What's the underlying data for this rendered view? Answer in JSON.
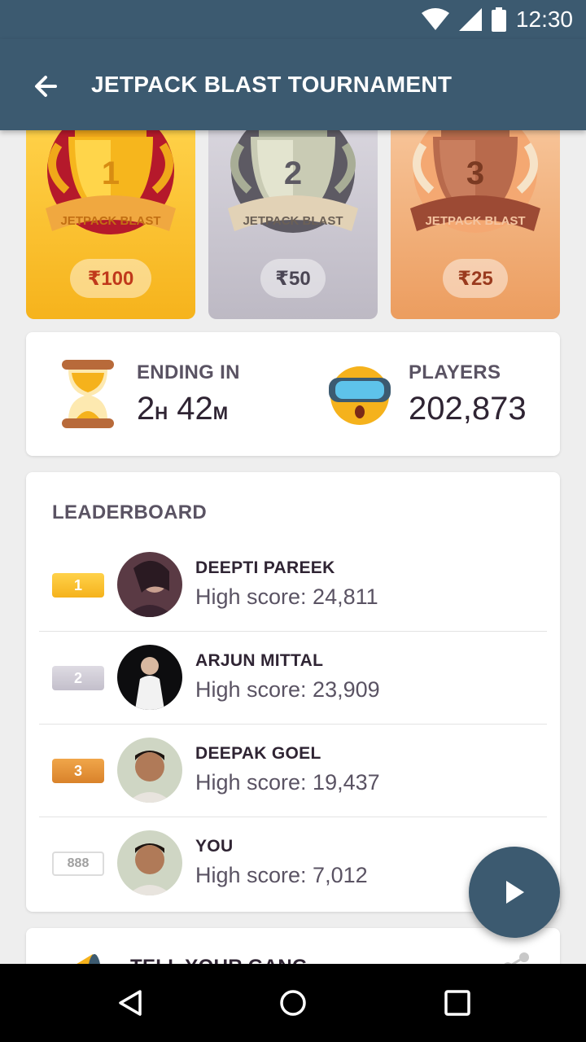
{
  "status_bar": {
    "time": "12:30"
  },
  "app_bar": {
    "title": "JETPACK BLAST TOURNAMENT"
  },
  "prizes": [
    {
      "rank": "1",
      "banner": "JETPACK BLAST",
      "amount": "₹100"
    },
    {
      "rank": "2",
      "banner": "JETPACK BLAST",
      "amount": "₹50"
    },
    {
      "rank": "3",
      "banner": "JETPACK BLAST",
      "amount": "₹25"
    }
  ],
  "stats": {
    "ending_label": "ENDING IN",
    "ending_hours": "2",
    "ending_hours_unit": "H",
    "ending_minutes": "42",
    "ending_minutes_unit": "M",
    "players_label": "PLAYERS",
    "players_value": "202,873"
  },
  "leaderboard": {
    "title": "LEADERBOARD",
    "rows": [
      {
        "rank": "1",
        "name": "DEEPTI PAREEK",
        "score": "High score: 24,811"
      },
      {
        "rank": "2",
        "name": "ARJUN MITTAL",
        "score": "High score: 23,909"
      },
      {
        "rank": "3",
        "name": "DEEPAK GOEL",
        "score": "High score: 19,437"
      },
      {
        "rank": "888",
        "name": "YOU",
        "score": "High score: 7,012"
      }
    ]
  },
  "share": {
    "label": "TELL YOUR GANG"
  },
  "colors": {
    "primary": "#3c5a70",
    "gold": "#f5b21c",
    "silver": "#c3bfcb",
    "bronze": "#d9822a"
  }
}
